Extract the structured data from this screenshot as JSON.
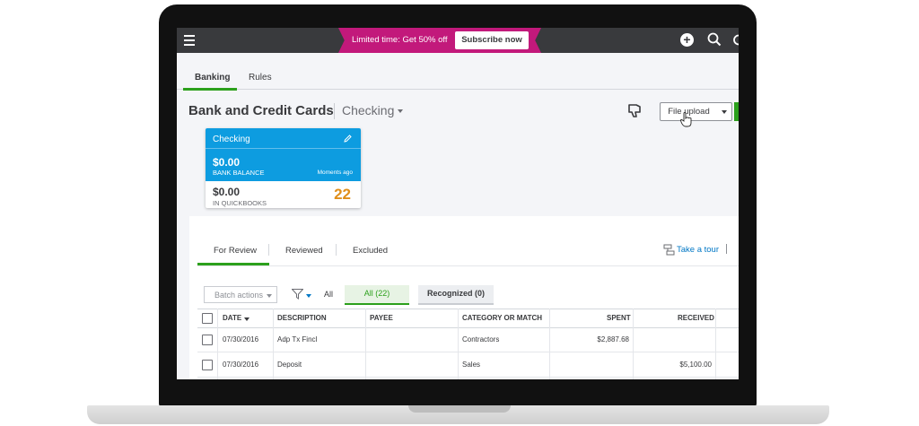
{
  "topbar": {
    "promo_text": "Limited time: Get 50% off",
    "subscribe_label": "Subscribe now",
    "icons": [
      "menu-icon",
      "plus-icon",
      "search-icon",
      "gear-icon"
    ]
  },
  "main_tabs": [
    {
      "label": "Banking",
      "active": true
    },
    {
      "label": "Rules",
      "active": false
    }
  ],
  "page": {
    "title": "Bank and Credit Cards",
    "account": "Checking"
  },
  "actions": {
    "file_upload_label": "File upload"
  },
  "account_card": {
    "name": "Checking",
    "bank_balance": "$0.00",
    "bank_balance_label": "BANK BALANCE",
    "updated": "Moments ago",
    "qb_balance": "$0.00",
    "qb_balance_label": "IN QUICKBOOKS",
    "pending_count": "22"
  },
  "sub_tabs": [
    {
      "label": "For Review",
      "active": true
    },
    {
      "label": "Reviewed",
      "active": false
    },
    {
      "label": "Excluded",
      "active": false
    }
  ],
  "tour_label": "Take a tour",
  "filters": {
    "batch_actions_label": "Batch actions",
    "all_label": "All",
    "pill_all": "All (22)",
    "pill_recognized": "Recognized (0)"
  },
  "table": {
    "headers": [
      "DATE",
      "DESCRIPTION",
      "PAYEE",
      "CATEGORY OR MATCH",
      "SPENT",
      "RECEIVED"
    ],
    "rows": [
      {
        "date": "07/30/2016",
        "description": "Adp Tx Fincl",
        "payee": "",
        "category": "Contractors",
        "spent": "$2,887.68",
        "received": ""
      },
      {
        "date": "07/30/2016",
        "description": "Deposit",
        "payee": "",
        "category": "Sales",
        "spent": "",
        "received": "$5,100.00"
      }
    ]
  },
  "colors": {
    "topbar": "#393a3d",
    "promo": "#c2197b",
    "accent_green": "#2ca01c",
    "card_blue": "#0d9ce0",
    "count_orange": "#e08f1a",
    "link_blue": "#0077c5"
  }
}
